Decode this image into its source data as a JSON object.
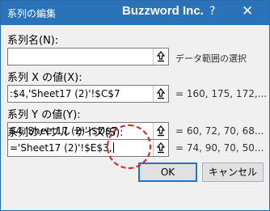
{
  "window": {
    "title": "系列の編集",
    "watermark": "Buzzword Inc.",
    "help_label": "?",
    "close_label": "✕"
  },
  "series_name": {
    "label": "系列名(N):",
    "value": "",
    "hint": "データ範囲の選択"
  },
  "x_values": {
    "label": "系列 X の値(X):",
    "value": ":$4,'Sheet17 (2)'!$C$7",
    "result": "= 160, 175, 172,..."
  },
  "y_values": {
    "label": "系列 Y の値(Y):",
    "value": "$4,'Sheet17 (2)'!$D$7",
    "result": "= 60, 72, 70, 68..."
  },
  "bubble_size": {
    "label": "系列のバブル サイズ(S):",
    "value": "='Sheet17 (2)'!$E$3,",
    "result": "= 74, 90, 70, 50..."
  },
  "buttons": {
    "ok": "OK",
    "cancel": "キャンセル"
  },
  "colors": {
    "titlebar": "#2b73b8",
    "callout": "#e02020",
    "ok_border": "#1a73d6"
  }
}
